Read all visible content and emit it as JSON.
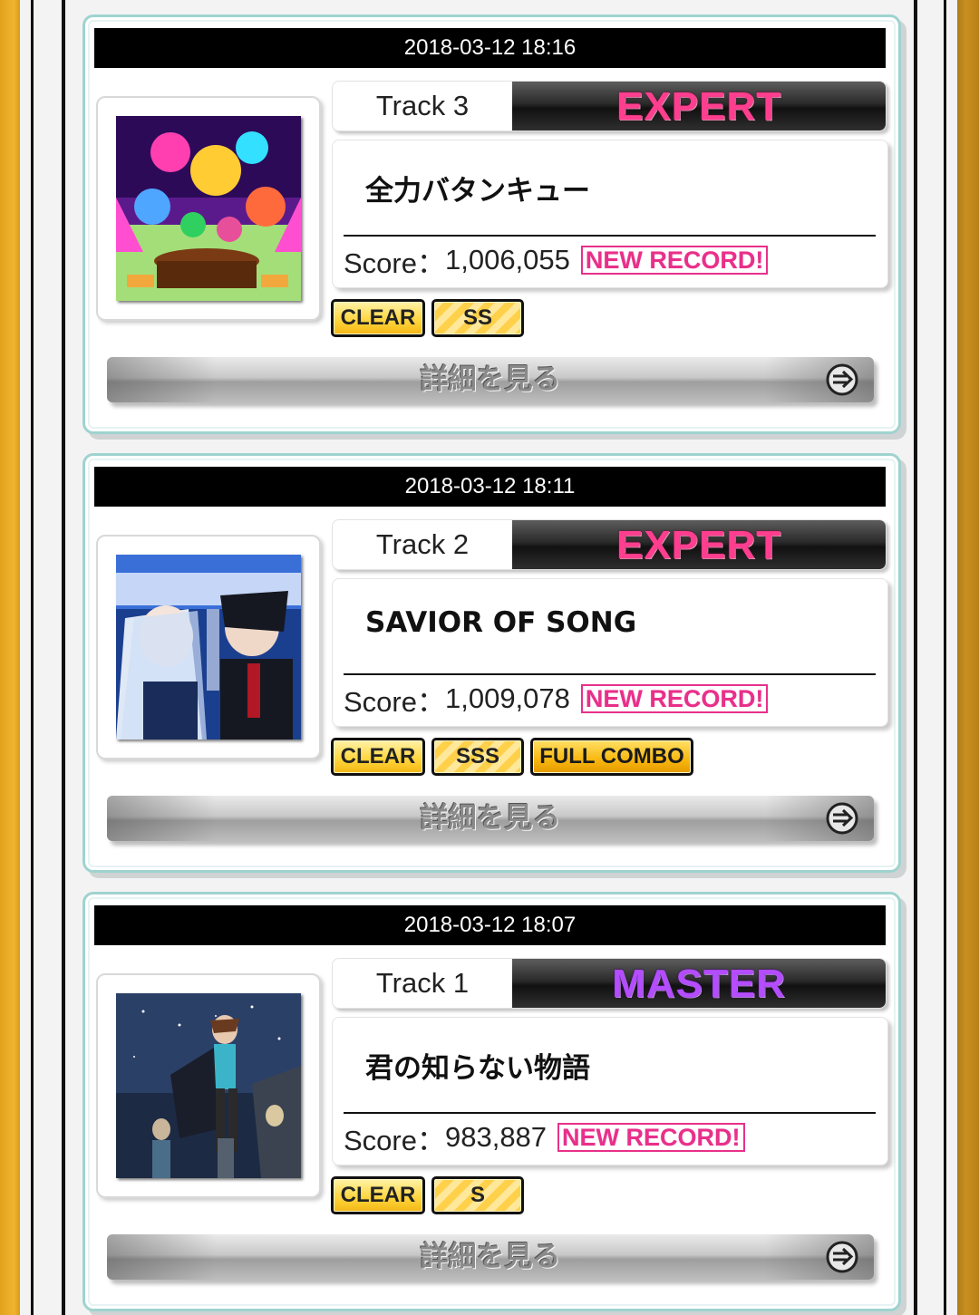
{
  "plays": [
    {
      "date": "2018-03-12 18:16",
      "track": "Track 3",
      "difficulty": "EXPERT",
      "title": "全力バタンキュー",
      "score_label": "Score：",
      "score": "1,006,055",
      "new_record": "NEW RECORD!",
      "badges": [
        "CLEAR",
        "SS"
      ],
      "detail_label": "詳細を見る"
    },
    {
      "date": "2018-03-12 18:11",
      "track": "Track 2",
      "difficulty": "EXPERT",
      "title": "SAVIOR OF SONG",
      "score_label": "Score：",
      "score": "1,009,078",
      "new_record": "NEW RECORD!",
      "badges": [
        "CLEAR",
        "SSS",
        "FULL COMBO"
      ],
      "detail_label": "詳細を見る"
    },
    {
      "date": "2018-03-12 18:07",
      "track": "Track 1",
      "difficulty": "MASTER",
      "title": "君の知らない物語",
      "score_label": "Score：",
      "score": "983,887",
      "new_record": "NEW RECORD!",
      "badges": [
        "CLEAR",
        "S"
      ],
      "detail_label": "詳細を見る"
    }
  ],
  "colors": {
    "expert": "#ff3e8f",
    "master": "#b44cff",
    "new_record": "#e8308a",
    "card_border": "#9fd3cf",
    "side_orange": "#f0b430"
  },
  "icons": {
    "detail_arrow": "circle-arrow-right-icon"
  }
}
